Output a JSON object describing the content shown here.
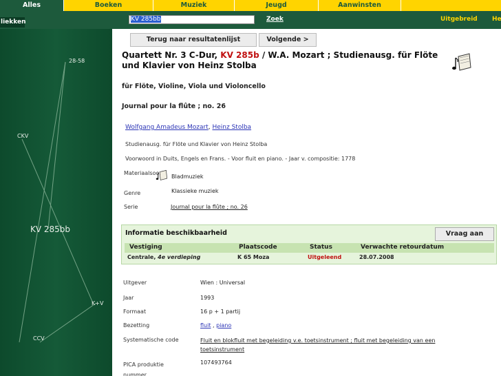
{
  "tabs": [
    {
      "label": "Alles",
      "active": true
    },
    {
      "label": "Boeken",
      "active": false
    },
    {
      "label": "Muziek",
      "active": false
    },
    {
      "label": "Jeugd",
      "active": false
    },
    {
      "label": "Aanwinsten",
      "active": false
    }
  ],
  "left_tab": "liekken",
  "search": {
    "value": "KV 285bb",
    "button": "Zoek"
  },
  "top_links": {
    "uitgebreid": "Uitgebreid",
    "help": "He"
  },
  "graph": {
    "nodes": [
      {
        "label": "28-58"
      },
      {
        "label": "CKV"
      },
      {
        "label": "KV 285bb"
      },
      {
        "label": "K+V"
      },
      {
        "label": "CCV"
      }
    ]
  },
  "nav": {
    "back": "Terug naar resultatenlijst",
    "next": "Volgende >"
  },
  "record": {
    "title_pre": "Quartett Nr. 3 C-Dur, ",
    "title_red": "KV 285b",
    "title_post": " / W.A. Mozart ; Studienausg. für Flöte und Klavier von Heinz Stolba",
    "subtitle": "für Flöte, Violine, Viola und Violoncello",
    "journal": "Journal pour la flûte ; no. 26",
    "author1": "Wolfgang Amadeus Mozart",
    "author_sep": ", ",
    "author2": "Heinz Stolba",
    "line1": "Studienausg. für Flöte und Klavier von Heinz Stolba",
    "line2": "Voorwoord in Duits, Engels en Frans. - Voor fluit en piano. - Jaar v. compositie: 1778",
    "materiaalsoort_label": "Materiaalsoort",
    "materiaalsoort_value": "Bladmuziek",
    "genre_label": "Genre",
    "genre_value": "Klassieke muziek",
    "serie_label": "Serie",
    "serie_value": "Journal pour la flûte ; no. 26"
  },
  "availability": {
    "title": "Informatie beschikbaarheid",
    "button": "Vraag aan",
    "headers": {
      "vestiging": "Vestiging",
      "plaatscode": "Plaatscode",
      "status": "Status",
      "retour": "Verwachte retourdatum"
    },
    "row": {
      "vestiging": "Centrale, ",
      "verdieping": "4e verdieping",
      "plaatscode": "K 65 Moza",
      "status": "Uitgeleend",
      "retour": "28.07.2008"
    }
  },
  "details": [
    {
      "label": "Uitgever",
      "value": "Wien : Universal"
    },
    {
      "label": "Jaar",
      "value": "1993"
    },
    {
      "label": "Formaat",
      "value": "16 p + 1 partij"
    },
    {
      "label": "Bezetting",
      "link1": "fluit",
      "sep": " , ",
      "link2": "piano"
    },
    {
      "label": "Systematische code",
      "value": "Fluit en blokfluit met begeleiding v.e. toetsinstrument ; fluit met begeleiding van een toetsinstrument"
    },
    {
      "label": "PICA produktie nummer",
      "value": "107493764"
    }
  ],
  "colors": {
    "green": "#1d5a3c",
    "yellow": "#ffd400",
    "red": "#c01010",
    "link": "#2a33b5"
  }
}
